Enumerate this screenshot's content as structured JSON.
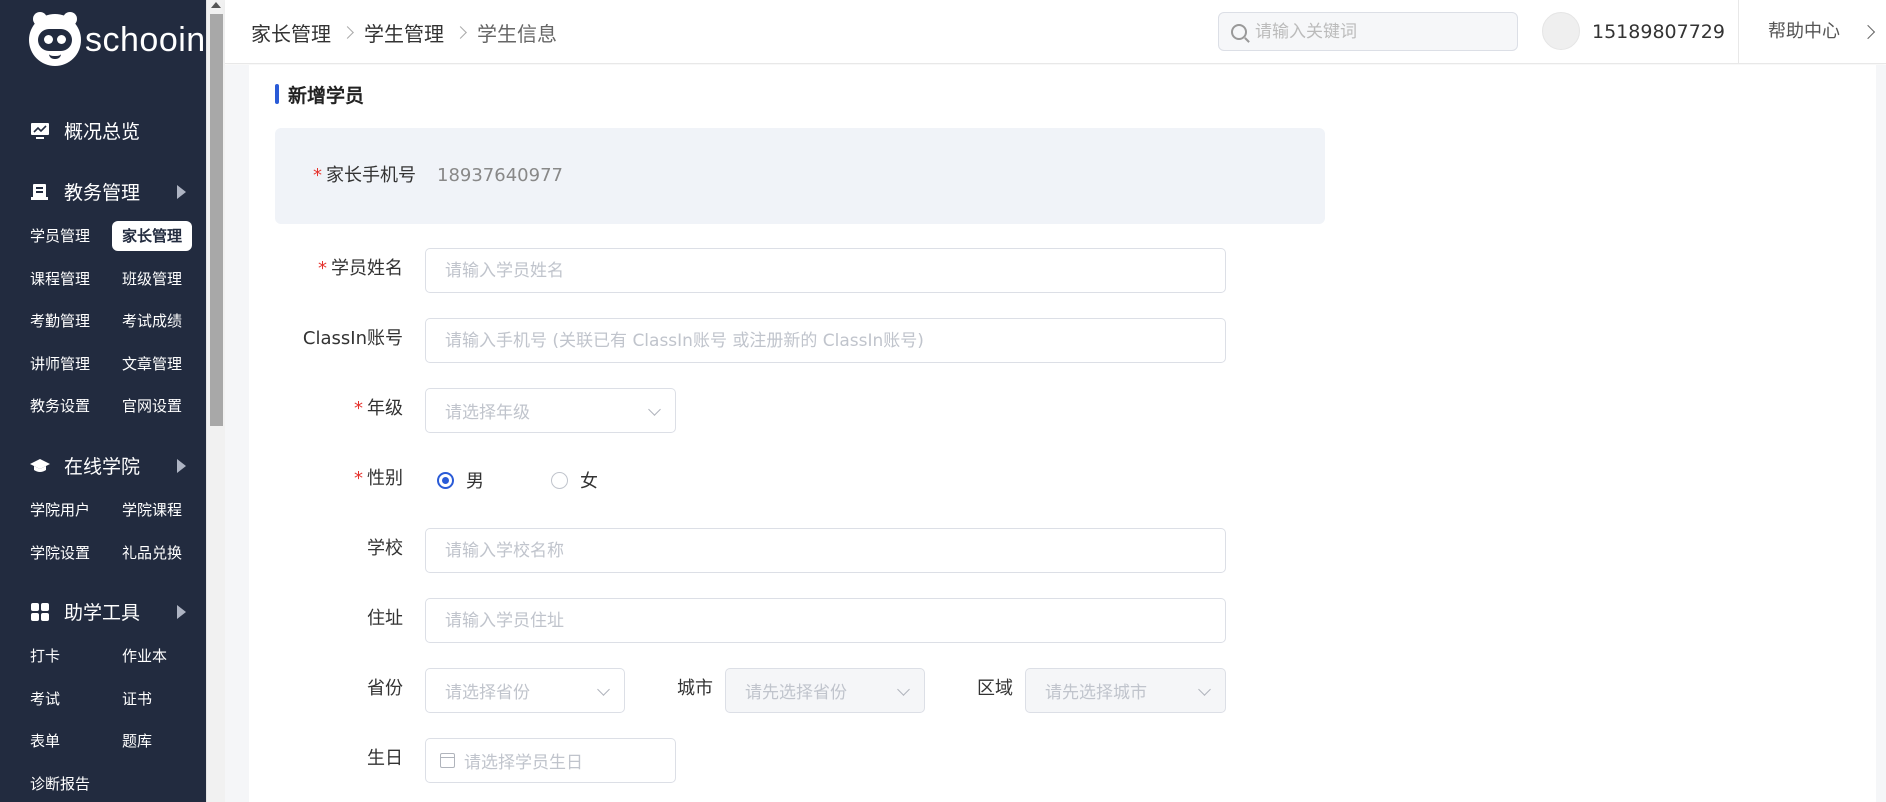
{
  "brand": {
    "name": "schooin"
  },
  "sidebar": {
    "groups": [
      {
        "label": "概况总览",
        "icon": "monitor-icon"
      },
      {
        "label": "教务管理",
        "icon": "book-icon"
      },
      {
        "label": "在线学院",
        "icon": "graduation-cap-icon"
      },
      {
        "label": "助学工具",
        "icon": "grid-icon"
      }
    ],
    "jiaowu_items": [
      "学员管理",
      "家长管理",
      "课程管理",
      "班级管理",
      "考勤管理",
      "考试成绩",
      "讲师管理",
      "文章管理",
      "教务设置",
      "官网设置"
    ],
    "xueyuan_items": [
      "学院用户",
      "学院课程",
      "学院设置",
      "礼品兑换"
    ],
    "tools_items": [
      "打卡",
      "作业本",
      "考试",
      "证书",
      "表单",
      "题库",
      "诊断报告"
    ],
    "active_item": "家长管理"
  },
  "header": {
    "breadcrumb": [
      "家长管理",
      "学生管理",
      "学生信息"
    ],
    "search_placeholder": "请输入关键词",
    "phone": "15189807729",
    "help": "帮助中心"
  },
  "form": {
    "title": "新增学员",
    "parent_phone_label": "家长手机号",
    "parent_phone_value": "18937640977",
    "name_label": "学员姓名",
    "name_placeholder": "请输入学员姓名",
    "classin_label": "ClassIn账号",
    "classin_placeholder": "请输入手机号 (关联已有 ClassIn账号 或注册新的 ClassIn账号)",
    "grade_label": "年级",
    "grade_placeholder": "请选择年级",
    "gender_label": "性别",
    "gender_options": [
      "男",
      "女"
    ],
    "gender_selected": "男",
    "school_label": "学校",
    "school_placeholder": "请输入学校名称",
    "address_label": "住址",
    "address_placeholder": "请输入学员住址",
    "province_label": "省份",
    "province_placeholder": "请选择省份",
    "city_label": "城市",
    "city_placeholder": "请先选择省份",
    "district_label": "区域",
    "district_placeholder": "请先选择城市",
    "birthday_label": "生日",
    "birthday_placeholder": "请选择学员生日"
  }
}
